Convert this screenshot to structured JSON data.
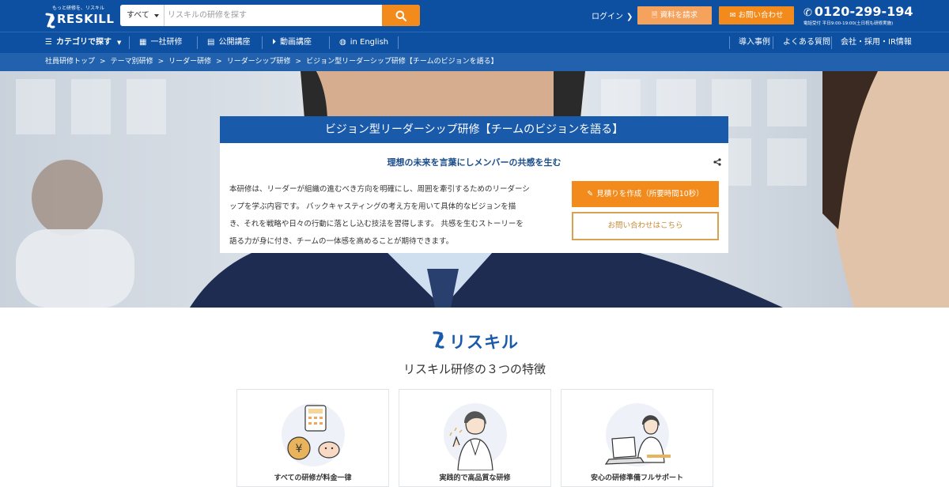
{
  "header": {
    "logo_tagline": "もっと研修を、リスキル",
    "logo_text": "RESKILL",
    "search_category": "すべて",
    "search_placeholder": "リスキルの研修を探す",
    "login_label": "ログイン",
    "doc_request_label": "資料を請求",
    "contact_label": "お問い合わせ",
    "phone_number": "0120-299-194",
    "phone_hours": "電話受付 平日9:00-19:00(土日祝も研修実施)"
  },
  "nav": {
    "items": [
      {
        "label": "カテゴリで探す",
        "icon": "menu-icon"
      },
      {
        "label": "一社研修",
        "icon": "presentation-icon"
      },
      {
        "label": "公開講座",
        "icon": "calendar-icon"
      },
      {
        "label": "動画講座",
        "icon": "play-icon"
      },
      {
        "label": "in English",
        "icon": "globe-icon"
      }
    ],
    "right_items": [
      {
        "label": "導入事例"
      },
      {
        "label": "よくある質問"
      },
      {
        "label": "会社・採用・IR情報"
      }
    ]
  },
  "breadcrumb": [
    "社員研修トップ",
    "テーマ別研修",
    "リーダー研修",
    "リーダーシップ研修",
    "ビジョン型リーダーシップ研修【チームのビジョンを語る】"
  ],
  "hero": {
    "title": "ビジョン型リーダーシップ研修【チームのビジョンを語る】",
    "subtitle": "理想の未来を言葉にしメンバーの共感を生む",
    "body_lines": [
      "本研修は、リーダーが組織の進むべき方向を明確にし、周囲を牽引するためのリーダーシ",
      "ップを学ぶ内容です。 バックキャスティングの考え方を用いて具体的なビジョンを描",
      "き、それを戦略や日々の行動に落とし込む技法を習得します。 共感を生むストーリーを",
      "語る力が身に付き、チームの一体感を高めることが期待できます。"
    ],
    "estimate_button": "見積りを作成（所要時間10秒）",
    "inquiry_button": "お問い合わせはこちら"
  },
  "features": {
    "brand": "リスキル",
    "title": "リスキル研修の３つの特徴",
    "cards": [
      {
        "label": "すべての研修が料金一律",
        "icon": "coin-calculator-illustration"
      },
      {
        "label": "実践的で高品質な研修",
        "icon": "instructor-illustration"
      },
      {
        "label": "安心の研修準備フルサポート",
        "icon": "support-staff-illustration"
      }
    ]
  },
  "colors": {
    "header_blue": "#0d4fa0",
    "breadcrumb_blue": "#2161ad",
    "accent_orange": "#f28a1c",
    "doc_orange": "#f5a25d",
    "inquiry_border": "#d7a253"
  }
}
